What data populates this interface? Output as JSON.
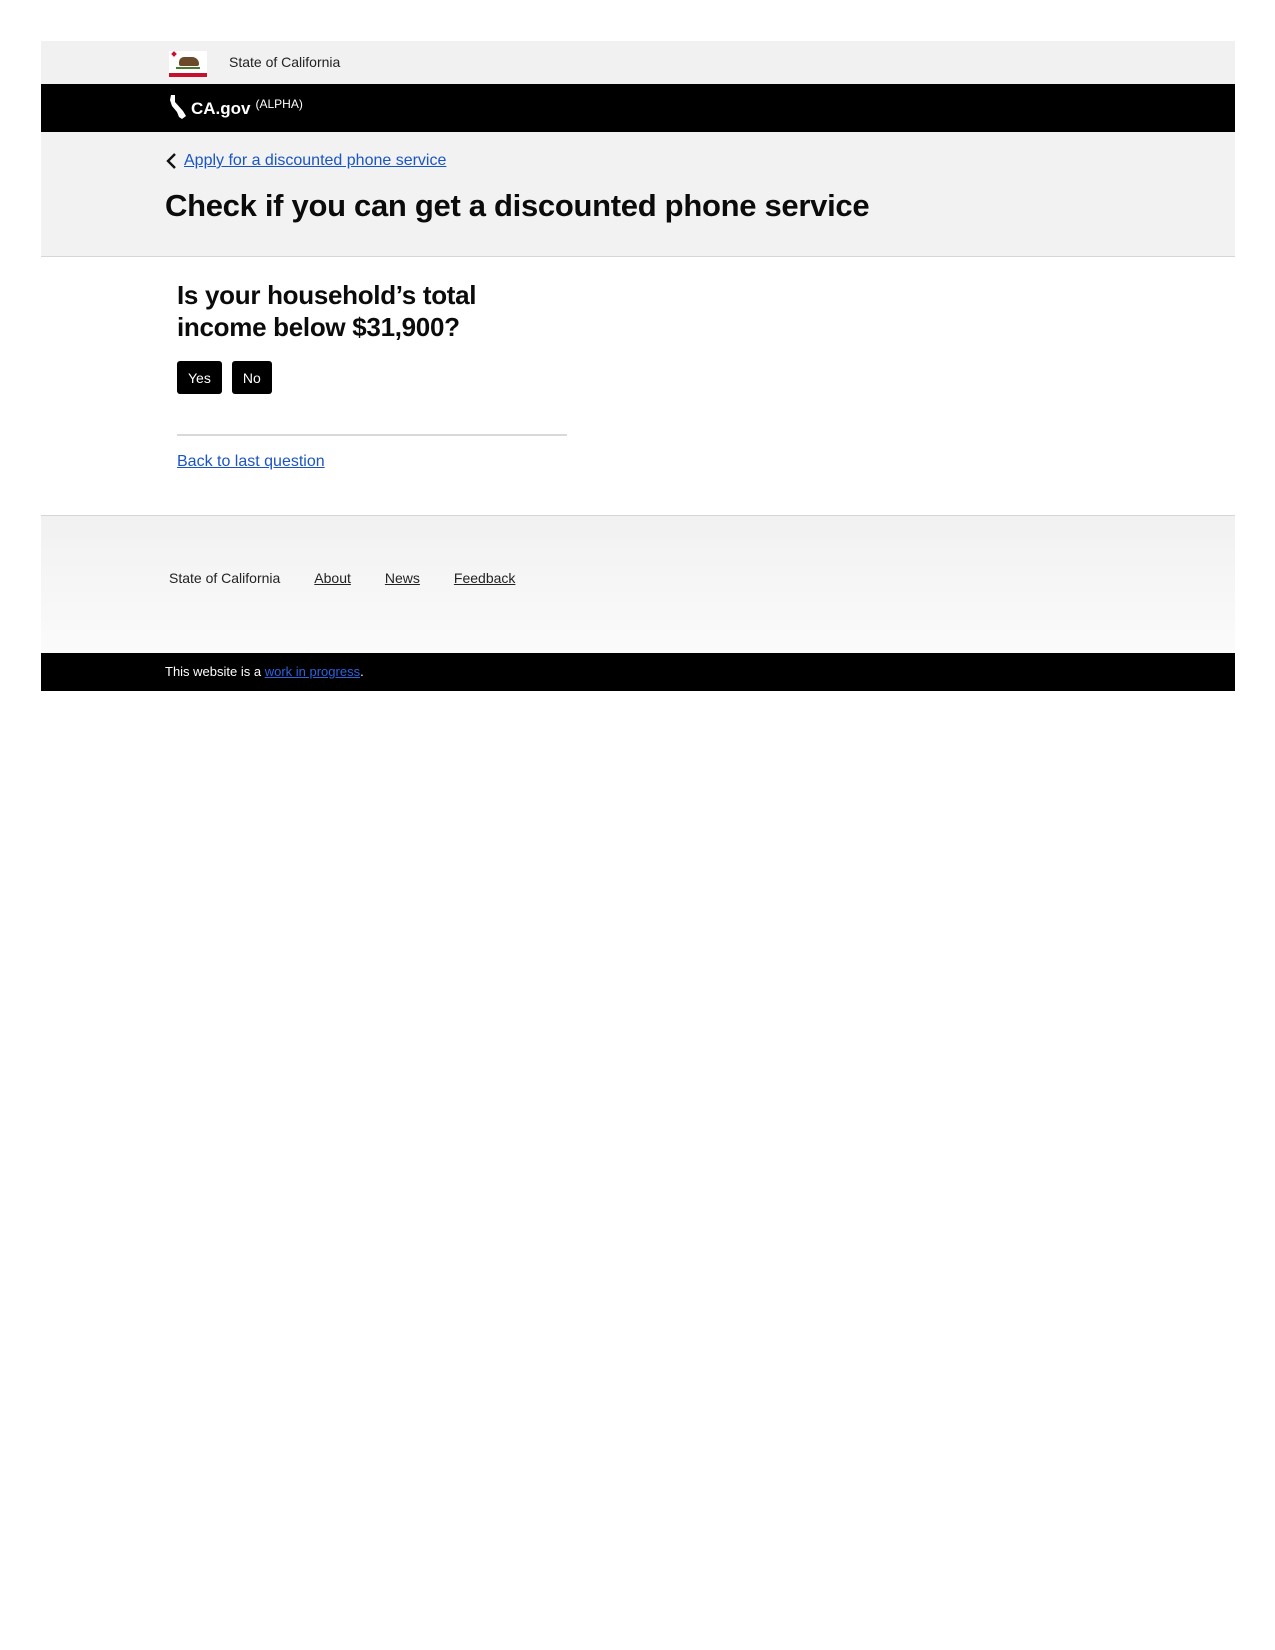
{
  "utility_bar": {
    "state_name": "State of California",
    "flag_icon": "california-flag-icon"
  },
  "brand_bar": {
    "name": "CA.gov",
    "tag": "(ALPHA)",
    "icon": "california-state-outline-icon"
  },
  "header": {
    "breadcrumb": {
      "icon": "chevron-left-icon",
      "label": "Apply for a discounted phone service"
    },
    "title": "Check if you can get a discounted phone service"
  },
  "main": {
    "question": "Is your household’s total income below $31,900?",
    "answers": {
      "yes_label": "Yes",
      "no_label": "No"
    },
    "back_link": "Back to last question"
  },
  "footer": {
    "state_name": "State of California",
    "links": {
      "about": "About",
      "news": "News",
      "feedback": "Feedback"
    }
  },
  "status_bar": {
    "prefix": "This website is a ",
    "link": "work in progress",
    "suffix": "."
  },
  "colors": {
    "link": "#1a55c4",
    "bar_black": "#000000",
    "header_gray": "#f2f2f2",
    "flag_red": "#c8102e"
  }
}
